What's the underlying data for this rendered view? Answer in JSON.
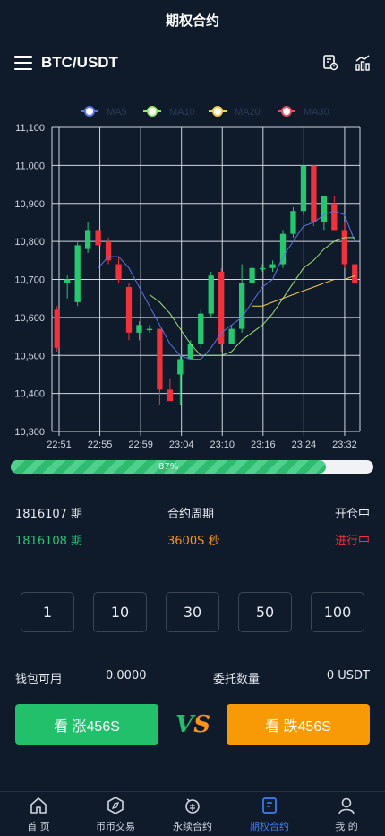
{
  "title": "期权合约",
  "pair": "BTC/USDT",
  "colors": {
    "bg": "#0f1a2b",
    "up": "#26c76f",
    "down": "#f0323c",
    "accent": "#3b7ff5",
    "orange": "#f7931e"
  },
  "chart_data": {
    "type": "candlestick",
    "legend": [
      "MA5",
      "MA10",
      "MA20",
      "MA30"
    ],
    "legend_colors": [
      "#5b74e8",
      "#9ee37a",
      "#f2d04a",
      "#e05060"
    ],
    "yticks": [
      "11,100",
      "11,000",
      "10,900",
      "10,800",
      "10,700",
      "10,600",
      "10,500",
      "10,400",
      "10,300"
    ],
    "ylim": [
      10300,
      11100
    ],
    "xticks": [
      "22:51",
      "22:55",
      "22:59",
      "23:04",
      "23:10",
      "23:16",
      "23:24",
      "23:32"
    ],
    "candles": [
      {
        "o": 10620,
        "c": 10520,
        "h": 10630,
        "l": 10510
      },
      {
        "o": 10690,
        "c": 10700,
        "h": 10710,
        "l": 10650
      },
      {
        "o": 10640,
        "c": 10790,
        "h": 10800,
        "l": 10630
      },
      {
        "o": 10780,
        "c": 10830,
        "h": 10850,
        "l": 10770
      },
      {
        "o": 10830,
        "c": 10790,
        "h": 10840,
        "l": 10780
      },
      {
        "o": 10800,
        "c": 10750,
        "h": 10810,
        "l": 10740
      },
      {
        "o": 10740,
        "c": 10700,
        "h": 10760,
        "l": 10690
      },
      {
        "o": 10680,
        "c": 10560,
        "h": 10690,
        "l": 10540
      },
      {
        "o": 10560,
        "c": 10580,
        "h": 10590,
        "l": 10540
      },
      {
        "o": 10570,
        "c": 10570,
        "h": 10580,
        "l": 10560
      },
      {
        "o": 10570,
        "c": 10410,
        "h": 10570,
        "l": 10370
      },
      {
        "o": 10410,
        "c": 10380,
        "h": 10440,
        "l": 10380
      },
      {
        "o": 10450,
        "c": 10490,
        "h": 10500,
        "l": 10370
      },
      {
        "o": 10490,
        "c": 10530,
        "h": 10540,
        "l": 10490
      },
      {
        "o": 10530,
        "c": 10610,
        "h": 10620,
        "l": 10520
      },
      {
        "o": 10610,
        "c": 10710,
        "h": 10720,
        "l": 10600
      },
      {
        "o": 10720,
        "c": 10530,
        "h": 10730,
        "l": 10510
      },
      {
        "o": 10530,
        "c": 10570,
        "h": 10580,
        "l": 10530
      },
      {
        "o": 10570,
        "c": 10690,
        "h": 10740,
        "l": 10560
      },
      {
        "o": 10690,
        "c": 10730,
        "h": 10740,
        "l": 10680
      },
      {
        "o": 10730,
        "c": 10730,
        "h": 10740,
        "l": 10720
      },
      {
        "o": 10730,
        "c": 10740,
        "h": 10750,
        "l": 10720
      },
      {
        "o": 10740,
        "c": 10820,
        "h": 10830,
        "l": 10730
      },
      {
        "o": 10820,
        "c": 10880,
        "h": 10890,
        "l": 10810
      },
      {
        "o": 10880,
        "c": 11000,
        "h": 11000,
        "l": 10870
      },
      {
        "o": 11000,
        "c": 10850,
        "h": 11000,
        "l": 10840
      },
      {
        "o": 10850,
        "c": 10920,
        "h": 10920,
        "l": 10830
      },
      {
        "o": 10900,
        "c": 10830,
        "h": 10920,
        "l": 10830
      },
      {
        "o": 10830,
        "c": 10740,
        "h": 10850,
        "l": 10730
      },
      {
        "o": 10740,
        "c": 10690,
        "h": 10740,
        "l": 10690
      }
    ],
    "ma5": [
      null,
      null,
      null,
      null,
      10730,
      10760,
      10760,
      10730,
      10680,
      10630,
      10580,
      10530,
      10500,
      10490,
      10490,
      10520,
      10560,
      10580,
      10600,
      10640,
      10680,
      10700,
      10760,
      10800,
      10840,
      10850,
      10870,
      10880,
      10870,
      10800
    ],
    "ma10": [
      null,
      null,
      null,
      null,
      null,
      null,
      null,
      null,
      null,
      10660,
      10640,
      10610,
      10570,
      10530,
      10500,
      10500,
      10500,
      10510,
      10540,
      10560,
      10580,
      10610,
      10650,
      10690,
      10730,
      10750,
      10780,
      10800,
      10810,
      10810
    ],
    "ma20": [
      null,
      null,
      null,
      null,
      null,
      null,
      null,
      null,
      null,
      null,
      null,
      null,
      null,
      null,
      null,
      null,
      null,
      null,
      null,
      10630,
      10630,
      10640,
      10650,
      10660,
      10670,
      10680,
      10690,
      10700,
      10700,
      10710
    ],
    "ma30": []
  },
  "progress": {
    "percent": 87,
    "label": "87%"
  },
  "period": {
    "current_id": "1816107 期",
    "cycle_label": "合约周期",
    "status_open": "开仓中",
    "next_id": "1816108 期",
    "cycle_value": "3600S 秒",
    "status_running": "进行中"
  },
  "amounts": [
    "1",
    "10",
    "30",
    "50",
    "100"
  ],
  "wallet": {
    "label": "钱包可用",
    "value": "0.0000",
    "qty_label": "委托数量",
    "qty_value": "0 USDT"
  },
  "buttons": {
    "up": "看 涨456S",
    "down": "看 跌456S",
    "vs_v": "V",
    "vs_s": "S"
  },
  "tabs": [
    {
      "label": "首 页",
      "icon": "home-icon"
    },
    {
      "label": "币币交易",
      "icon": "compass-icon"
    },
    {
      "label": "永续合约",
      "icon": "exchange-icon"
    },
    {
      "label": "期权合约",
      "icon": "document-icon",
      "active": true
    },
    {
      "label": "我 的",
      "icon": "user-icon"
    }
  ]
}
